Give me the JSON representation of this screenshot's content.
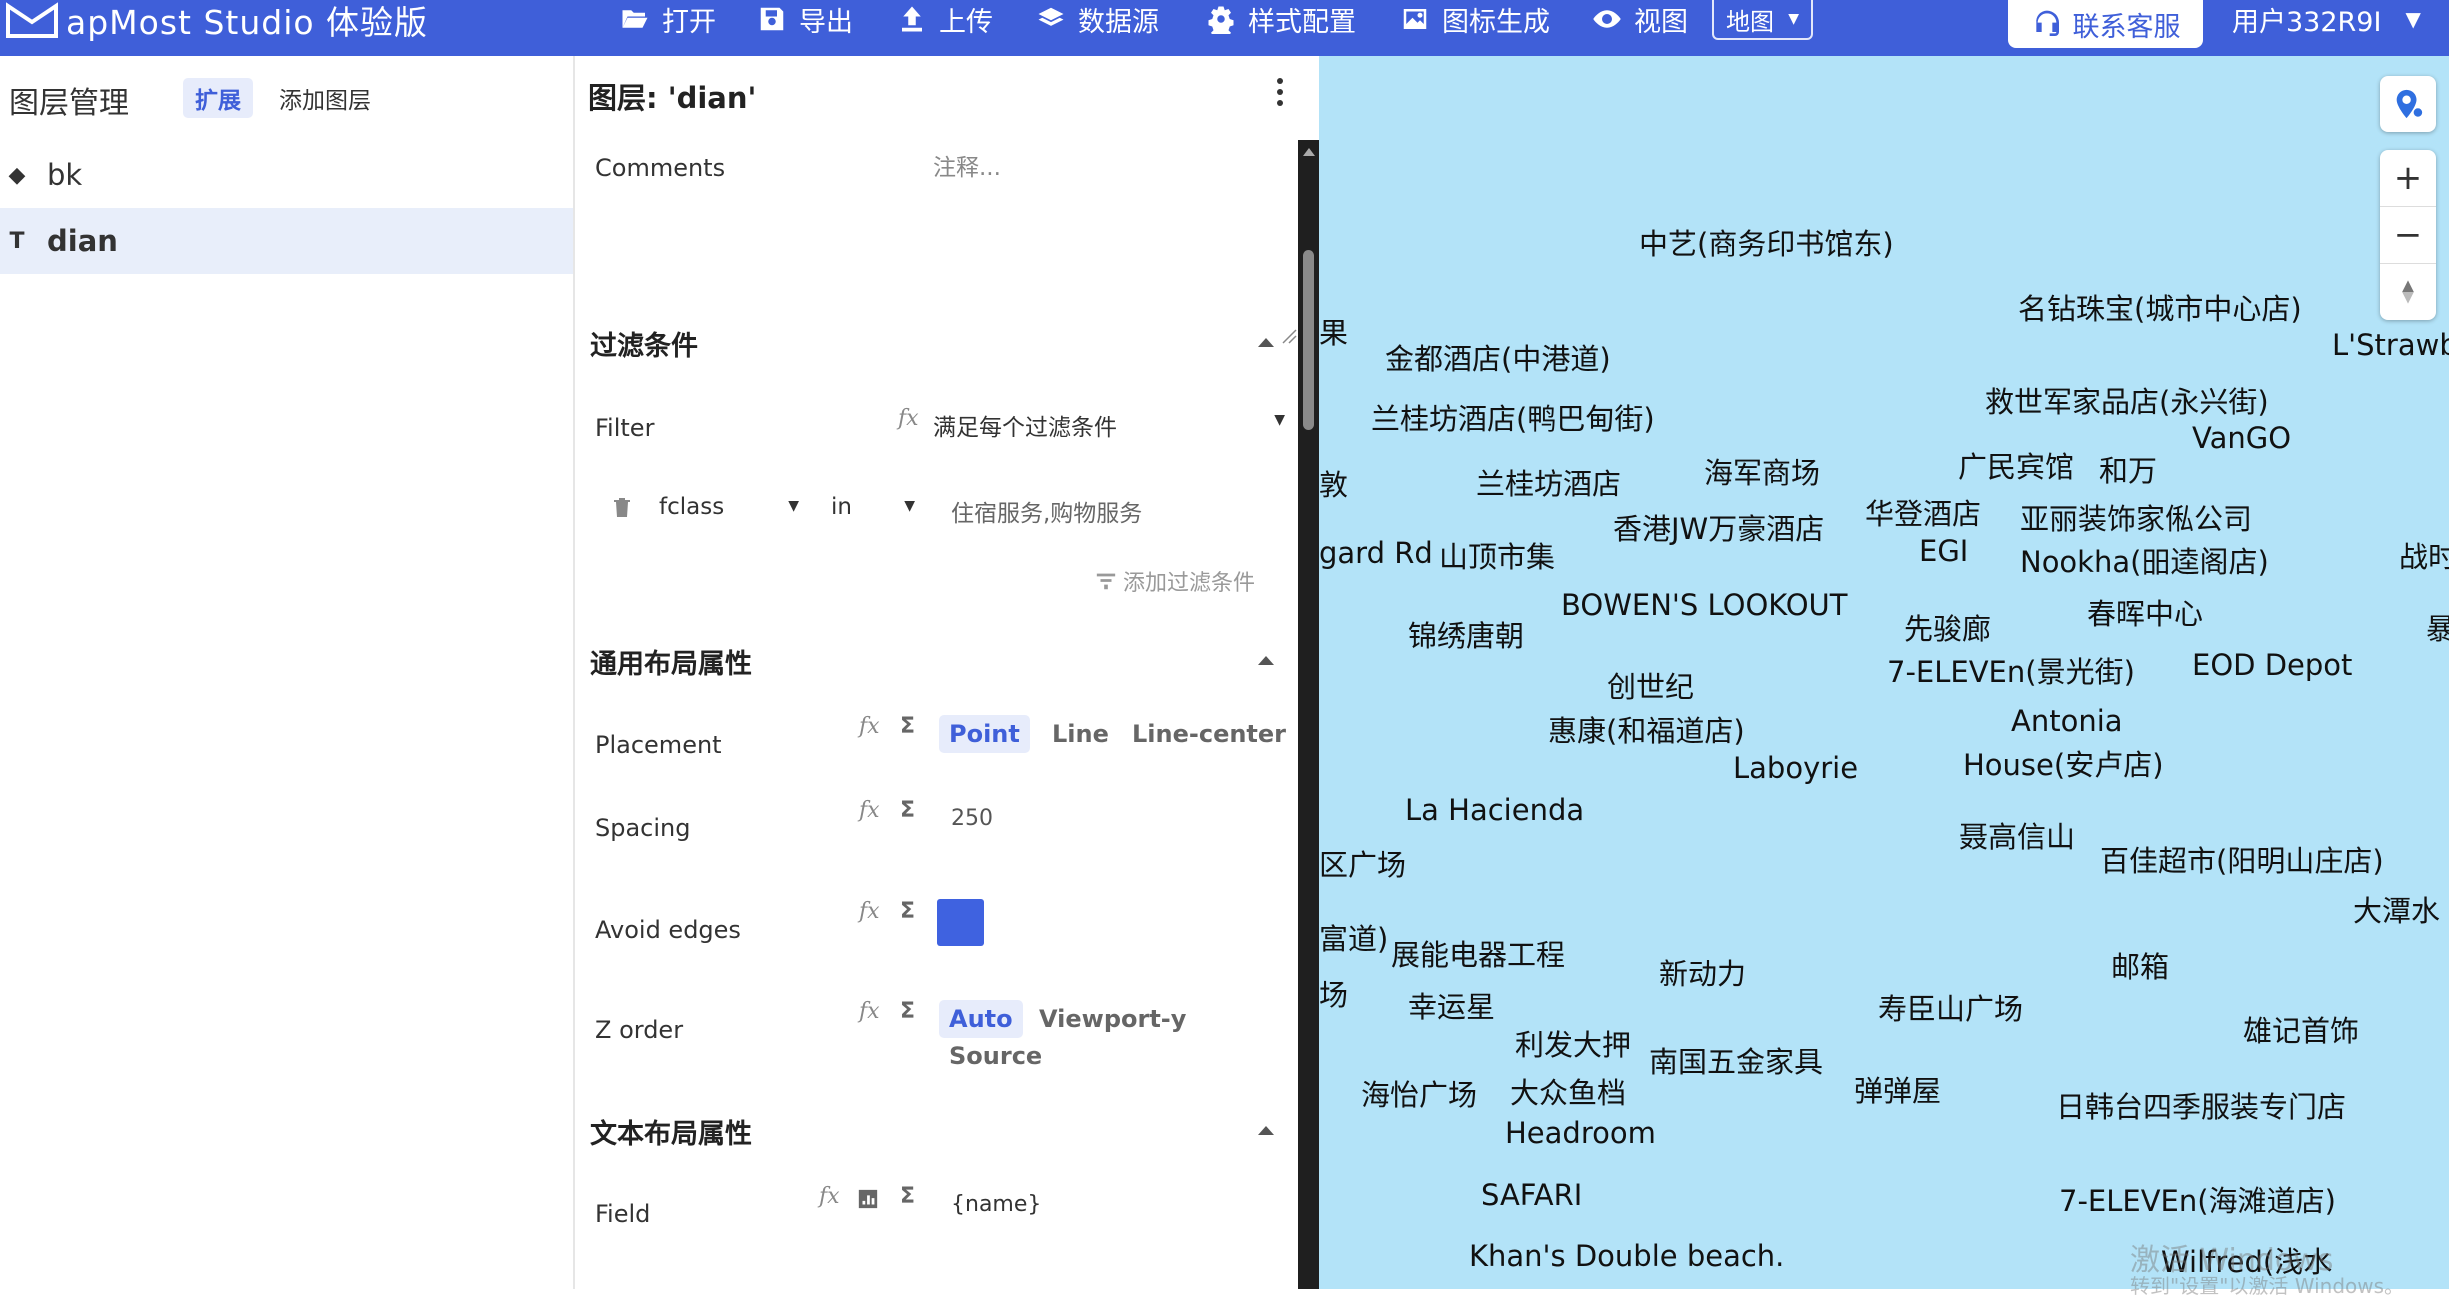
{
  "topbar": {
    "logo_text": "apMost Studio 体验版",
    "menu": [
      {
        "label": "打开",
        "icon": "folder-open-icon"
      },
      {
        "label": "导出",
        "icon": "save-icon"
      },
      {
        "label": "上传",
        "icon": "upload-icon"
      },
      {
        "label": "数据源",
        "icon": "layers-stack-icon"
      },
      {
        "label": "样式配置",
        "icon": "gear-icon"
      },
      {
        "label": "图标生成",
        "icon": "image-icon"
      },
      {
        "label": "视图",
        "icon": "eye-icon"
      }
    ],
    "view_select": "地图",
    "support_label": "联系客服",
    "user_label": "用户332R9I"
  },
  "layers_panel": {
    "title": "图层管理",
    "tabs": {
      "expand": "扩展",
      "add_layer": "添加图层"
    },
    "layers": [
      {
        "icon": "diamond-icon",
        "name": "bk"
      },
      {
        "icon": "text-layer-icon",
        "name": "dian"
      }
    ]
  },
  "props": {
    "title": "图层: 'dian'",
    "comments_label": "Comments",
    "comments_placeholder": "注释...",
    "filter_section": "过滤条件",
    "filter_label": "Filter",
    "filter_value": "满足每个过滤条件",
    "filter_field": "fclass",
    "filter_op": "in",
    "filter_values": "住宿服务,购物服务",
    "add_filter": "添加过滤条件",
    "general_section": "通用布局属性",
    "placement_label": "Placement",
    "placement_options": [
      "Point",
      "Line",
      "Line-center"
    ],
    "spacing_label": "Spacing",
    "spacing_value": "250",
    "avoid_edges_label": "Avoid edges",
    "avoid_edges_checked": true,
    "z_order_label": "Z order",
    "z_order_options": [
      "Auto",
      "Viewport-y",
      "Source"
    ],
    "text_section": "文本布局属性",
    "field_label": "Field",
    "field_value": "{name}"
  },
  "map": {
    "labels": [
      "中艺(商务印书馆东)",
      "名钻珠宝(城市中心店)",
      "L'Strawb",
      "果",
      "金都酒店(中港道)",
      "救世军家品店(永兴街)",
      "兰桂坊酒店(鸭巴甸街)",
      "VanGO",
      "广民宾馆",
      "和万",
      "敦",
      "兰桂坊酒店",
      "海军商场",
      "华登酒店",
      "亚丽装饰家俬公司",
      "香港JW万豪酒店",
      "gard Rd",
      "山顶市集",
      "EGI",
      "Nookha(昍逵阁店)",
      "战时",
      "BOWEN'S LOOKOUT",
      "春晖中心",
      "锦绣唐朝",
      "先骏廊",
      "暴",
      "7-ELEVEn(景光街)",
      "EOD Depot",
      "创世纪",
      "惠康(和福道店)",
      "Antonia",
      "House(安卢店)",
      "Laboyrie",
      "La Hacienda",
      "聂高信山",
      "百佳超市(阳明山庄店)",
      "区广场",
      "大潭水",
      "富道)",
      "展能电器工程",
      "新动力",
      "邮箱",
      "场",
      "幸运星",
      "寿臣山广场",
      "利发大押",
      "雄记首饰",
      "南国五金家具",
      "海怡广场",
      "大众鱼档",
      "弹弹屋",
      "日韩台四季服装专门店",
      "Headroom",
      "SAFARI",
      "7-ELEVEn(海滩道店)",
      "Khan's Double beach.",
      "Wilfred(浅水"
    ],
    "watermark": "激活 Windows",
    "watermark_sub": "转到\"设置\"以激活 Windows。"
  },
  "colors": {
    "brand": "#3f5fd9",
    "map_water": "#b3e3f8",
    "selected_row": "#e8eefa"
  }
}
